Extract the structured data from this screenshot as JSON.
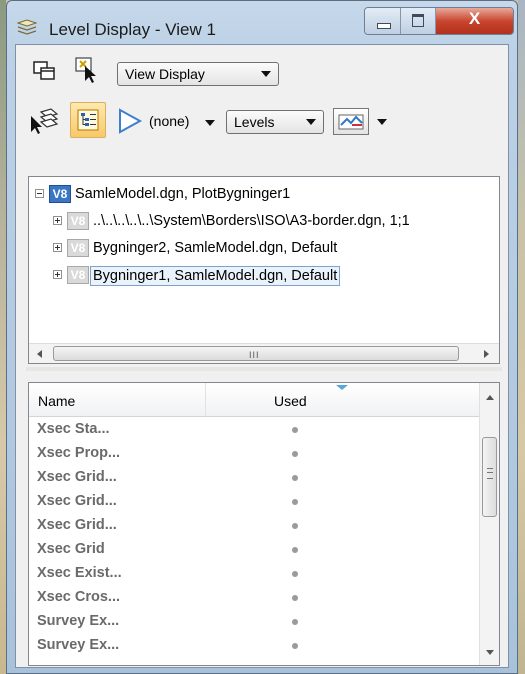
{
  "window": {
    "title": "Level Display - View 1",
    "close_glyph": "X"
  },
  "toolbar": {
    "view_mode_dropdown": "View Display",
    "filter_value": "(none)",
    "mode_dropdown": "Levels"
  },
  "tree": {
    "badge": "V8",
    "root": "SamleModel.dgn, PlotBygninger1",
    "children": [
      {
        "label": "..\\..\\..\\..\\..\\System\\Borders\\ISO\\A3-border.dgn, 1;1"
      },
      {
        "label": "Bygninger2, SamleModel.dgn, Default"
      },
      {
        "label": "Bygninger1, SamleModel.dgn, Default",
        "selected": true
      }
    ],
    "scroll_grip": "III"
  },
  "levels": {
    "columns": {
      "name": "Name",
      "used": "Used"
    },
    "rows": [
      {
        "name": "Xsec Sta...",
        "used": true
      },
      {
        "name": "Xsec Prop...",
        "used": true
      },
      {
        "name": "Xsec Grid...",
        "used": true
      },
      {
        "name": "Xsec Grid...",
        "used": true
      },
      {
        "name": "Xsec Grid...",
        "used": true
      },
      {
        "name": "Xsec Grid",
        "used": true
      },
      {
        "name": "Xsec Exist...",
        "used": true
      },
      {
        "name": "Xsec Cros...",
        "used": true
      },
      {
        "name": "Survey Ex...",
        "used": true
      },
      {
        "name": "Survey Ex...",
        "used": true
      }
    ]
  },
  "colors": {
    "accent_blue": "#5aa6dc",
    "selection_border": "#7da2ce",
    "selection_fill": "#eaf3fc",
    "close_button": "#c8462f",
    "level_text": "#6a6a6a",
    "v8_badge": "#3a76c4"
  },
  "icons": [
    "level-display-app-icon",
    "views-icon",
    "select-element-icon",
    "level-manager-icon",
    "tree-view-toggle-icon",
    "filter-funnel-icon",
    "display-symbology-icon",
    "v8-file-icon"
  ]
}
